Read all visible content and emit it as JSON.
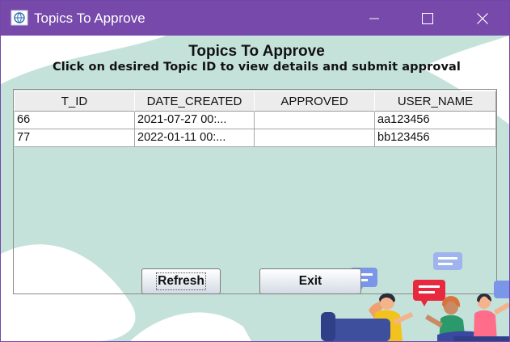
{
  "window": {
    "title": "Topics To Approve",
    "icons": {
      "app": "globe-app-icon",
      "minimize": "minimize-icon",
      "maximize": "maximize-icon",
      "close": "close-icon"
    }
  },
  "page": {
    "heading": "Topics To Approve",
    "subheading": "Click on desired Topic ID to view details and submit approval"
  },
  "table": {
    "columns": [
      "T_ID",
      "DATE_CREATED",
      "APPROVED",
      "USER_NAME"
    ],
    "rows": [
      [
        "66",
        "2021-07-27 00:...",
        "",
        "aa123456"
      ],
      [
        "77",
        "2022-01-11 00:...",
        "",
        "bb123456"
      ]
    ]
  },
  "buttons": {
    "refresh": "Refresh",
    "exit": "Exit"
  },
  "colors": {
    "titlebar": "#7649ab",
    "background": "#c4e2da",
    "header_cell": "#ececec"
  }
}
